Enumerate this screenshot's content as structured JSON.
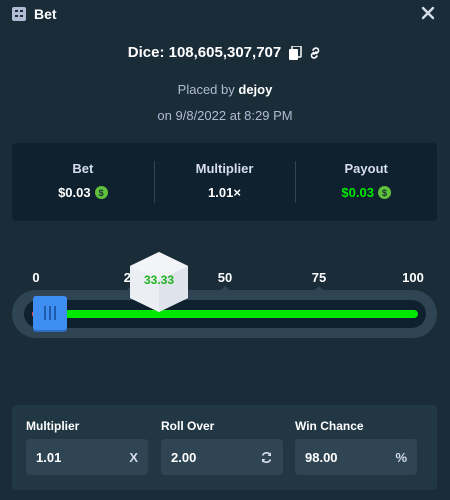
{
  "header": {
    "title": "Bet",
    "icon": "bet-slip-icon",
    "close_icon": "close-icon"
  },
  "dice": {
    "label": "Dice: 108,605,307,707",
    "copy_icon": "copy-icon",
    "link_icon": "link-icon"
  },
  "placed": {
    "prefix": "Placed by",
    "user": "dejoy"
  },
  "date": "on 9/8/2022 at 8:29 PM",
  "stats": {
    "bet": {
      "label": "Bet",
      "value": "$0.03"
    },
    "multiplier": {
      "label": "Multiplier",
      "value": "1.01×"
    },
    "payout": {
      "label": "Payout",
      "value": "$0.03"
    }
  },
  "slider": {
    "ticks": [
      "0",
      "25",
      "50",
      "75",
      "100"
    ],
    "roll_result": "33.33",
    "roll_over": 2.0,
    "colors": {
      "win": "#00e701",
      "lose": "#ff4d4d",
      "handle": "#3d8ef0"
    }
  },
  "inputs": {
    "multiplier": {
      "label": "Multiplier",
      "value": "1.01",
      "suffix": "X"
    },
    "roll_over": {
      "label": "Roll Over",
      "value": "2.00",
      "icon": "refresh-icon"
    },
    "win_chance": {
      "label": "Win Chance",
      "value": "98.00",
      "suffix": "%"
    }
  }
}
